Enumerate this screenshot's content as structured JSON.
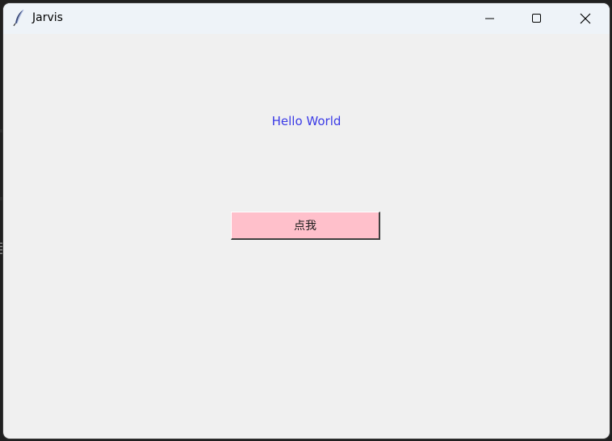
{
  "window": {
    "title": "Jarvis",
    "app_icon": "feather-icon",
    "controls": {
      "minimize_icon": "minimize-icon",
      "maximize_icon": "maximize-icon",
      "close_icon": "close-icon"
    }
  },
  "content": {
    "label_text": "Hello World",
    "label_color": "#3b3be6",
    "button_label": "点我",
    "button_color": "#ffc0cb"
  },
  "background": {
    "partial_glyph": "目"
  }
}
